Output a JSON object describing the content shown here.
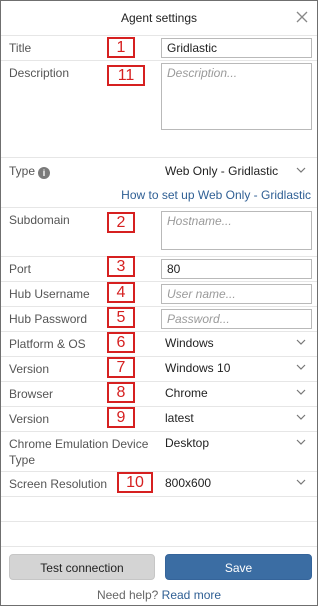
{
  "header": {
    "title": "Agent settings"
  },
  "fields": {
    "title": {
      "label": "Title",
      "value": "Gridlastic",
      "badge": "1"
    },
    "description": {
      "label": "Description",
      "placeholder": "Description...",
      "badge": "11"
    },
    "type": {
      "label": "Type",
      "value": "Web Only - Gridlastic",
      "help_link": "How to set up Web Only - Gridlastic"
    },
    "subdomain": {
      "label": "Subdomain",
      "placeholder": "Hostname...",
      "badge": "2"
    },
    "port": {
      "label": "Port",
      "value": "80",
      "badge": "3"
    },
    "hub_username": {
      "label": "Hub Username",
      "placeholder": "User name...",
      "badge": "4"
    },
    "hub_password": {
      "label": "Hub Password",
      "placeholder": "Password...",
      "badge": "5"
    },
    "platform_os": {
      "label": "Platform & OS",
      "value": "Windows",
      "badge": "6"
    },
    "os_version": {
      "label": "Version",
      "value": "Windows 10",
      "badge": "7"
    },
    "browser": {
      "label": "Browser",
      "value": "Chrome",
      "badge": "8"
    },
    "browser_version": {
      "label": "Version",
      "value": "latest",
      "badge": "9"
    },
    "emulation": {
      "label": "Chrome Emulation Device Type",
      "value": "Desktop"
    },
    "resolution": {
      "label": "Screen Resolution",
      "value": "800x600",
      "badge": "10"
    }
  },
  "buttons": {
    "test": "Test connection",
    "save": "Save"
  },
  "footer": {
    "text": "Need help?",
    "link": "Read more"
  },
  "colors": {
    "badge": "#d62020",
    "link": "#2f5f94",
    "save": "#3b6da3"
  }
}
